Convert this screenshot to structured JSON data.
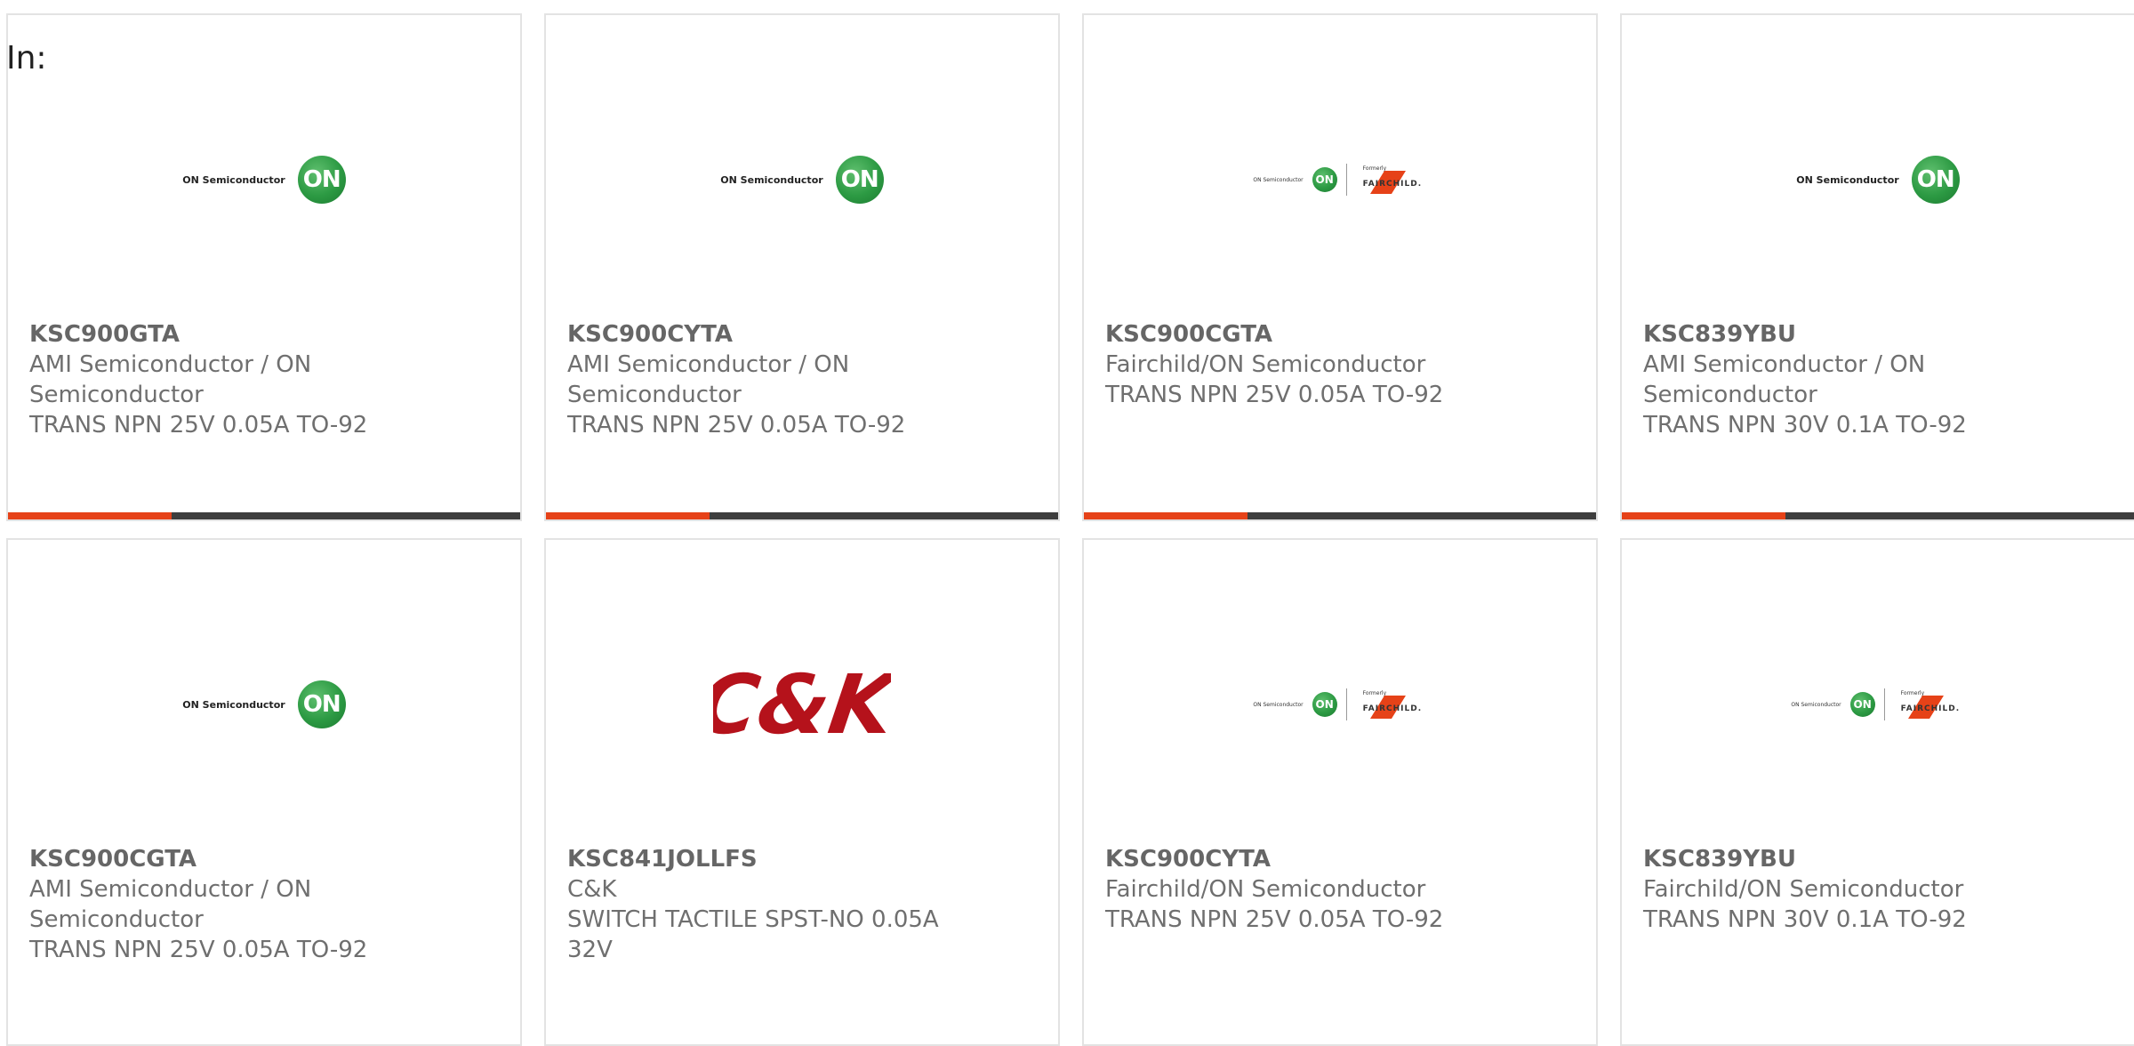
{
  "header": {
    "in_label": "In:"
  },
  "colors": {
    "accent": "#e64218",
    "bar_dark": "#3e3e3e",
    "on_green": "#2c9a43",
    "ck_red": "#b5121b"
  },
  "cards": [
    {
      "mpn": "KSC900GTA",
      "manufacturer": "AMI Semiconductor / ON Semiconductor",
      "description": "TRANS NPN 25V 0.05A TO-92",
      "logo": "on-semiconductor-logo",
      "logo_text": "ON Semiconductor",
      "logo_mark": "ON",
      "progress": 0.32
    },
    {
      "mpn": "KSC900CYTA",
      "manufacturer": "AMI Semiconductor / ON Semiconductor",
      "description": "TRANS NPN 25V 0.05A TO-92",
      "logo": "on-semiconductor-logo",
      "logo_text": "ON Semiconductor",
      "logo_mark": "ON",
      "progress": 0.32
    },
    {
      "mpn": "KSC900CGTA",
      "manufacturer": "Fairchild/ON Semiconductor",
      "description": "TRANS NPN 25V 0.05A TO-92",
      "logo": "on-fairchild-logo",
      "logo_text": "ON Semiconductor",
      "logo_mark": "ON",
      "logo_formerly": "Formerly",
      "logo_fairchild": "FAIRCHILD.",
      "progress": 0.32
    },
    {
      "mpn": "KSC839YBU",
      "manufacturer": "AMI Semiconductor / ON Semiconductor",
      "description": "TRANS NPN 30V 0.1A TO-92",
      "logo": "on-semiconductor-logo",
      "logo_text": "ON Semiconductor",
      "logo_mark": "ON",
      "progress": 0.32
    },
    {
      "mpn": "KSC900CGTA",
      "manufacturer": "AMI Semiconductor / ON Semiconductor",
      "description": "TRANS NPN 25V 0.05A TO-92",
      "logo": "on-semiconductor-logo",
      "logo_text": "ON Semiconductor",
      "logo_mark": "ON"
    },
    {
      "mpn": "KSC841JOLLFS",
      "manufacturer": "C&K",
      "description": "SWITCH TACTILE SPST-NO 0.05A 32V",
      "logo": "ck-logo",
      "logo_mark": "C&K"
    },
    {
      "mpn": "KSC900CYTA",
      "manufacturer": "Fairchild/ON Semiconductor",
      "description": "TRANS NPN 25V 0.05A TO-92",
      "logo": "on-fairchild-logo",
      "logo_text": "ON Semiconductor",
      "logo_mark": "ON",
      "logo_formerly": "Formerly",
      "logo_fairchild": "FAIRCHILD."
    },
    {
      "mpn": "KSC839YBU",
      "manufacturer": "Fairchild/ON Semiconductor",
      "description": "TRANS NPN 30V 0.1A TO-92",
      "logo": "on-fairchild-logo",
      "logo_text": "ON Semiconductor",
      "logo_mark": "ON",
      "logo_formerly": "Formerly",
      "logo_fairchild": "FAIRCHILD."
    }
  ]
}
